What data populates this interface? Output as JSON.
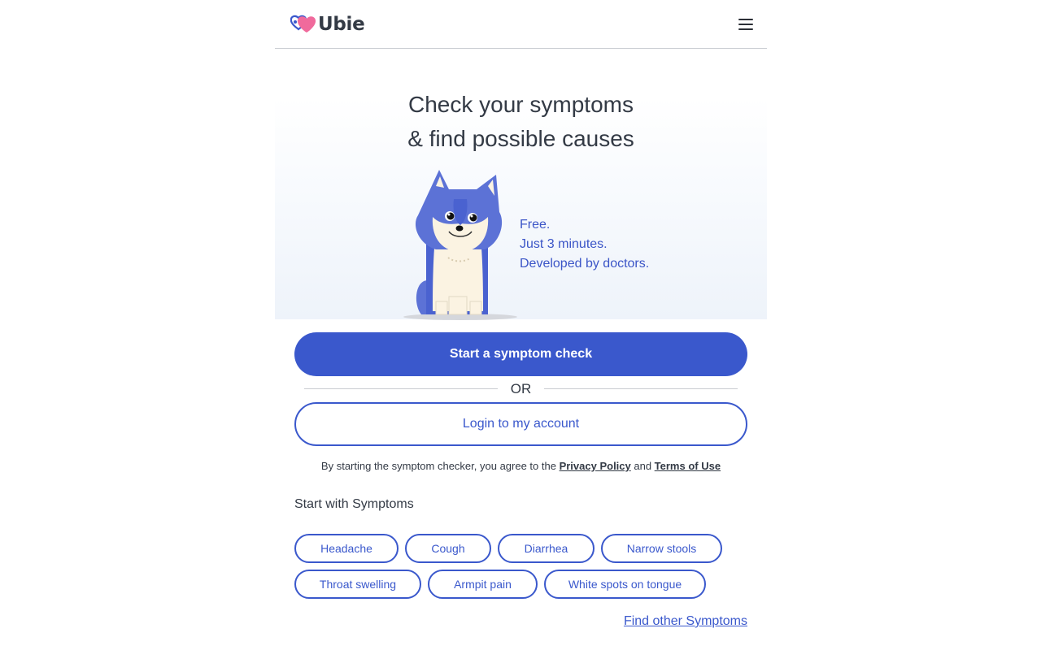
{
  "header": {
    "logo_text": "Ubie",
    "menu_icon": "hamburger-menu-icon"
  },
  "hero": {
    "title_line1": "Check your symptoms",
    "title_line2": "& find possible causes",
    "features": [
      "Free.",
      "Just 3 minutes.",
      "Developed by doctors."
    ]
  },
  "actions": {
    "start_label": "Start a symptom check",
    "or_label": "OR",
    "login_label": "Login to my account",
    "agree_prefix": "By starting the symptom checker, you agree to the ",
    "privacy_label": "Privacy Policy",
    "agree_and": " and ",
    "terms_label": "Terms of Use"
  },
  "symptoms": {
    "title": "Start with Symptoms",
    "chips": [
      "Headache",
      "Cough",
      "Diarrhea",
      "Narrow stools",
      "Throat swelling",
      "Armpit pain",
      "White spots on tongue"
    ],
    "find_other_label": "Find other Symptoms"
  },
  "colors": {
    "primary": "#3a58cc",
    "text": "#333a45",
    "logo_heart": "#f06a9c"
  }
}
